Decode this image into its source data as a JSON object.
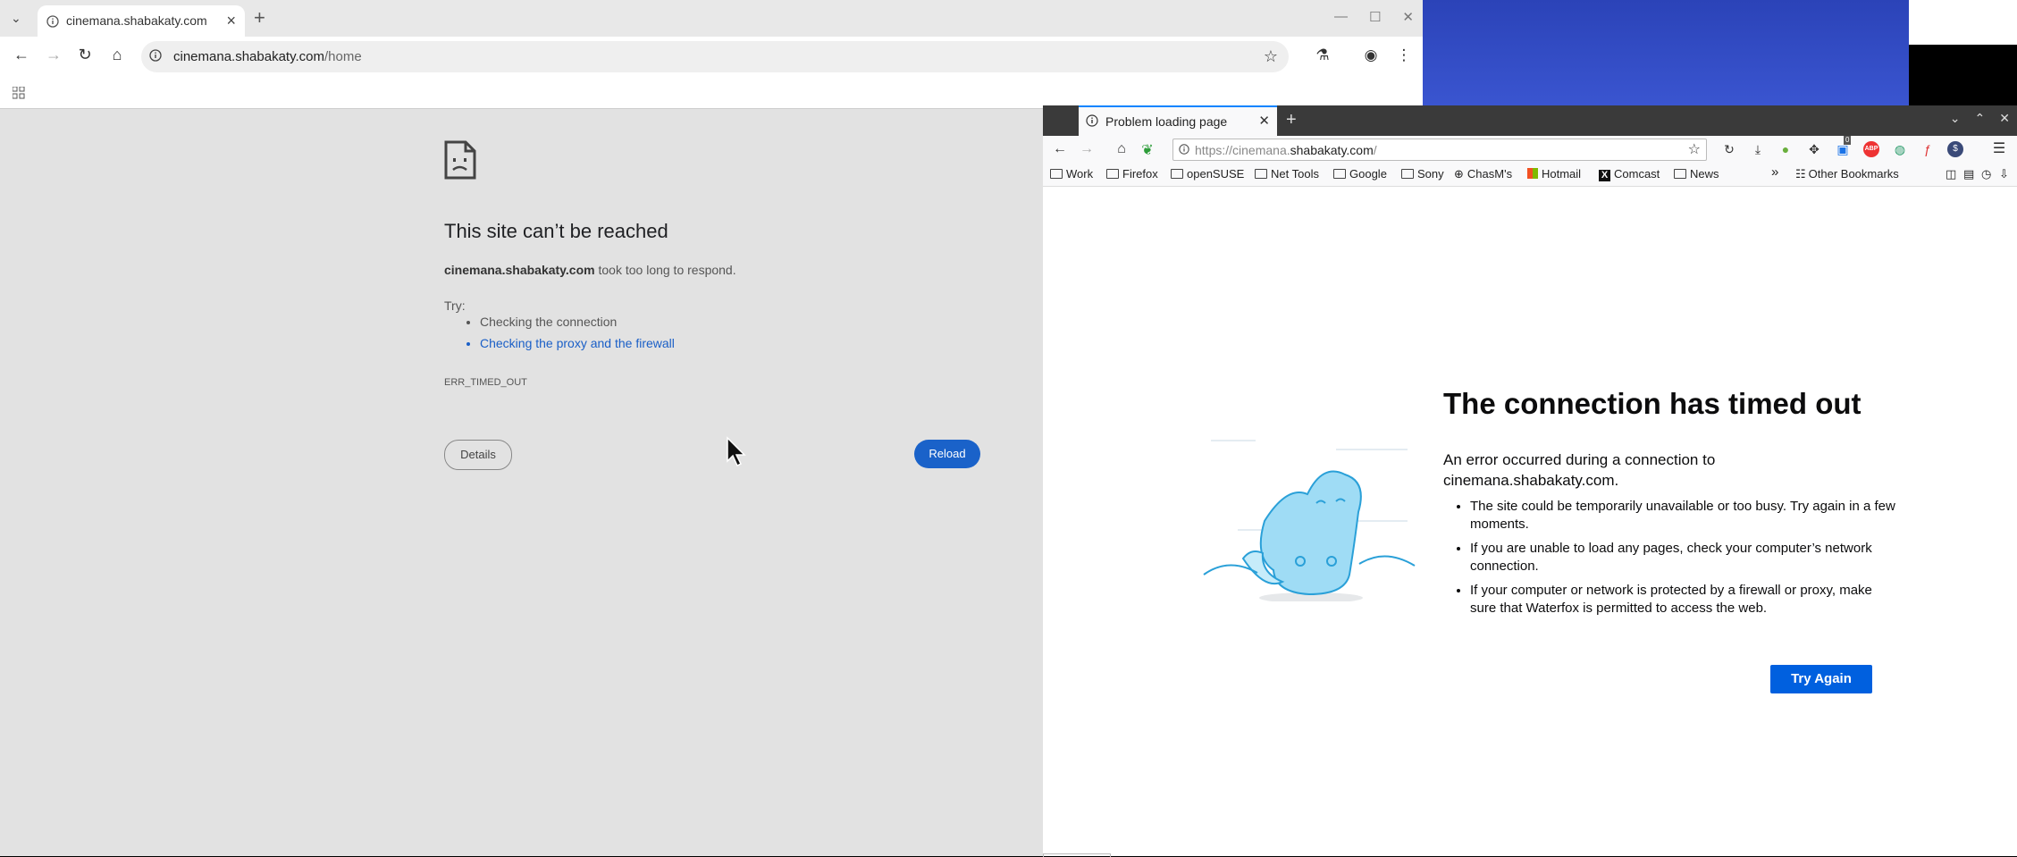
{
  "chrome": {
    "tab_title": "cinemana.shabakaty.com",
    "url_host": "cinemana.shabakaty.com",
    "url_path": "/home",
    "error": {
      "title": "This site can’t be reached",
      "host": "cinemana.shabakaty.com",
      "message": " took too long to respond.",
      "try_label": "Try:",
      "suggestions": [
        "Checking the connection",
        "Checking the proxy and the firewall"
      ],
      "code": "ERR_TIMED_OUT",
      "details_label": "Details",
      "reload_label": "Reload"
    },
    "colors": {
      "accent": "#1a62c9",
      "link": "#1a5fc7"
    }
  },
  "waterfox": {
    "tab_title": "Problem loading page",
    "url_prefix": "https://cinemana.",
    "url_domain": "shabakaty.com",
    "url_suffix": "/",
    "badge_count": "0",
    "bookmarks": [
      "Work",
      "Firefox",
      "openSUSE",
      "Net Tools",
      "Google",
      "Sony",
      "ChasM's",
      "Hotmail",
      "Comcast",
      "News"
    ],
    "other_bookmarks": "Other Bookmarks",
    "error": {
      "title": "The connection has timed out",
      "description": "An error occurred during a connection to cinemana.shabakaty.com.",
      "items": [
        "The site could be temporarily unavailable or too busy. Try again in a few moments.",
        "If you are unable to load any pages, check your computer’s network connection.",
        "If your computer or network is protected by a firewall or proxy, make sure that Waterfox is permitted to access the web."
      ],
      "try_again_label": "Try Again"
    },
    "colors": {
      "accent": "#0060df",
      "tab_highlight": "#0a84ff"
    }
  }
}
